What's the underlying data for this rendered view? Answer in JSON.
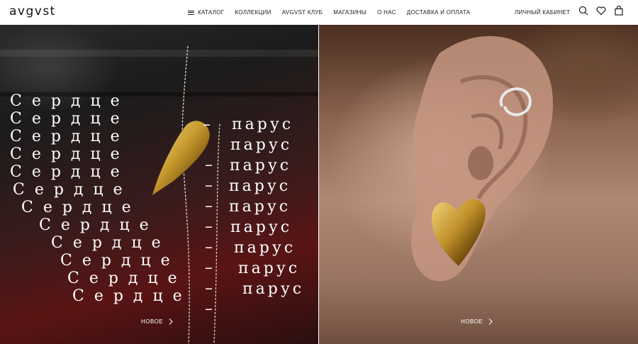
{
  "brand": {
    "logo": "avgvst"
  },
  "nav": {
    "items": [
      {
        "label": "КАТАЛОГ"
      },
      {
        "label": "КОЛЛЕКЦИИ"
      },
      {
        "label": "AVGVST КЛУБ"
      },
      {
        "label": "МАГАЗИНЫ"
      },
      {
        "label": "О НАС"
      },
      {
        "label": "ДОСТАВКА И ОПЛАТА"
      }
    ],
    "account_label": "ЛИЧНЫЙ КАБИНЕТ",
    "icons": [
      "search-icon",
      "heart-icon",
      "bag-icon"
    ]
  },
  "hero": {
    "left": {
      "typography": {
        "word_left": "Сердце",
        "dash": "–",
        "word_right": "парус"
      },
      "cta_label": "НОВОЕ"
    },
    "right": {
      "cta_label": "НОВОЕ"
    }
  },
  "colors": {
    "header_bg": "#ffffff",
    "text": "#111111",
    "overlay_text": "#ffffff"
  }
}
